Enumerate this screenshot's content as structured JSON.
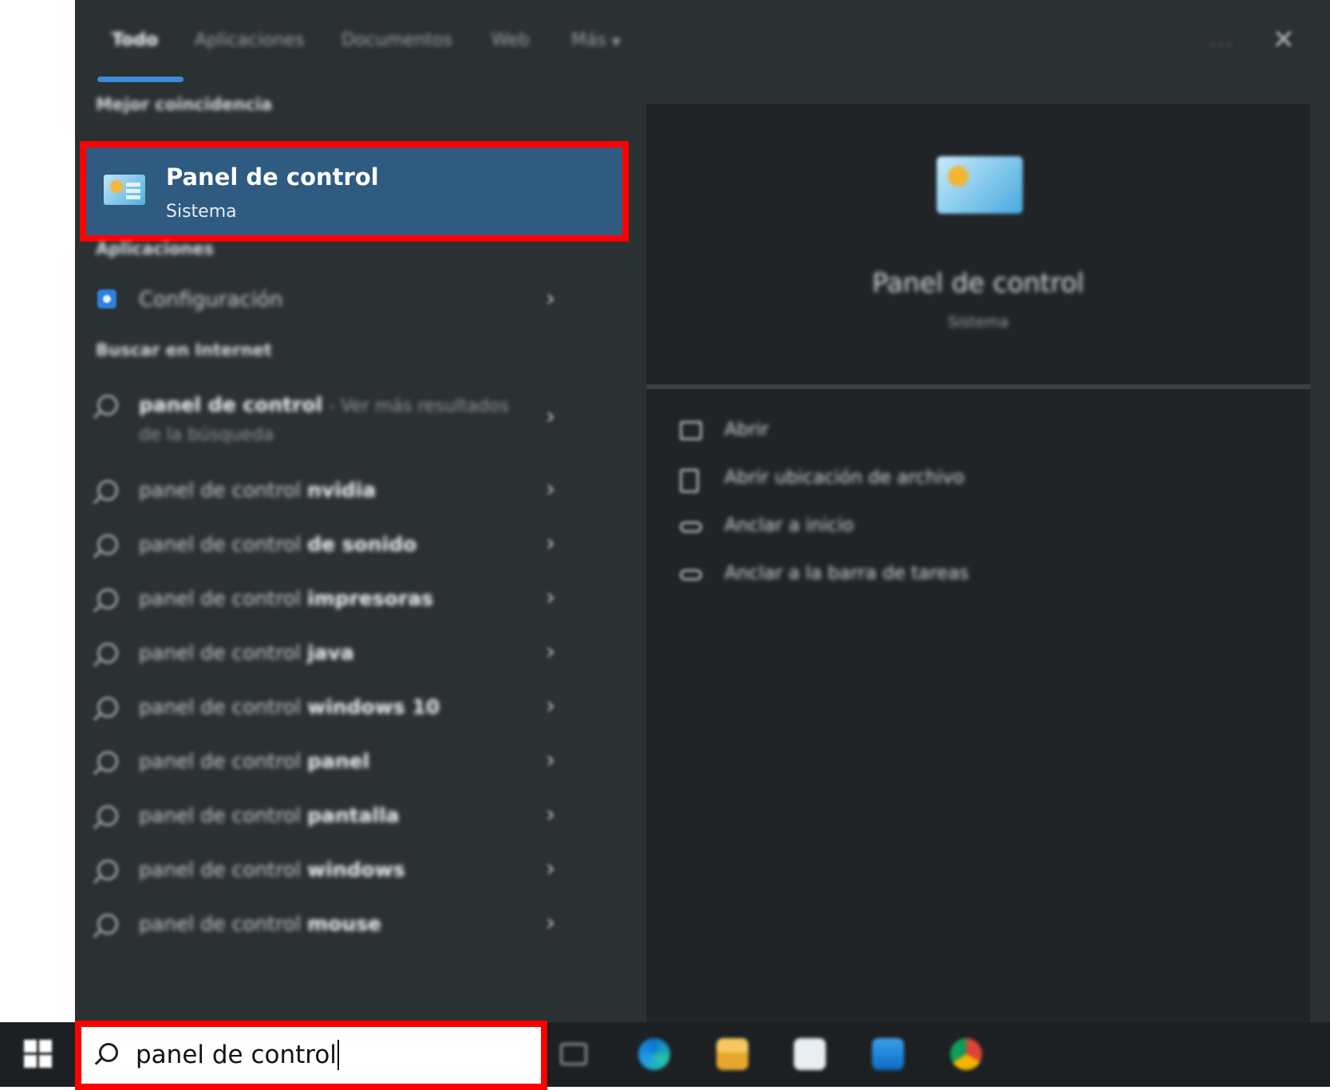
{
  "tabs": [
    {
      "label": "Todo",
      "active": true
    },
    {
      "label": "Aplicaciones",
      "active": false
    },
    {
      "label": "Documentos",
      "active": false
    },
    {
      "label": "Web",
      "active": false
    },
    {
      "label": "Más",
      "active": false
    }
  ],
  "window_controls": {
    "more_label": "···",
    "close_glyph": "✕"
  },
  "left": {
    "best_match_heading": "Mejor coincidencia",
    "best_match": {
      "title": "Panel de control",
      "subtitle": "Sistema",
      "icon": "control-panel-icon"
    },
    "apps_heading": "Aplicaciones",
    "apps": [
      {
        "label": "Configuración",
        "icon": "settings-gear-icon"
      }
    ],
    "web_heading": "Buscar en Internet",
    "web_results": [
      {
        "query": "panel de control",
        "suffix": "",
        "extra": "- Ver más resultados",
        "line2": "de la búsqueda"
      },
      {
        "query": "panel de control ",
        "suffix": "nvidia"
      },
      {
        "query": "panel de control ",
        "suffix": "de sonido"
      },
      {
        "query": "panel de control ",
        "suffix": "impresoras"
      },
      {
        "query": "panel de control ",
        "suffix": "java"
      },
      {
        "query": "panel de control ",
        "suffix": "windows 10"
      },
      {
        "query": "panel de control ",
        "suffix": "panel"
      },
      {
        "query": "panel de control ",
        "suffix": "pantalla"
      },
      {
        "query": "panel de control ",
        "suffix": "windows"
      },
      {
        "query": "panel de control ",
        "suffix": "mouse"
      }
    ]
  },
  "preview": {
    "title": "Panel de control",
    "subtitle": "Sistema",
    "actions": [
      {
        "label": "Abrir",
        "icon": "open-icon"
      },
      {
        "label": "Abrir ubicación de archivo",
        "icon": "file-location-icon"
      },
      {
        "label": "Anclar a inicio",
        "icon": "pin-icon"
      },
      {
        "label": "Anclar a la barra de tareas",
        "icon": "pin-taskbar-icon"
      }
    ]
  },
  "taskbar": {
    "search_value": "panel de control",
    "icons": [
      "task-view-icon",
      "edge-icon",
      "file-explorer-icon",
      "store-icon",
      "mail-icon",
      "chrome-icon"
    ]
  },
  "colors": {
    "panel_bg": "#2b3033",
    "preview_bg": "#202427",
    "selected_bg": "#2f5b80",
    "highlight_border": "#ff0000",
    "accent": "#3b8bd6"
  }
}
